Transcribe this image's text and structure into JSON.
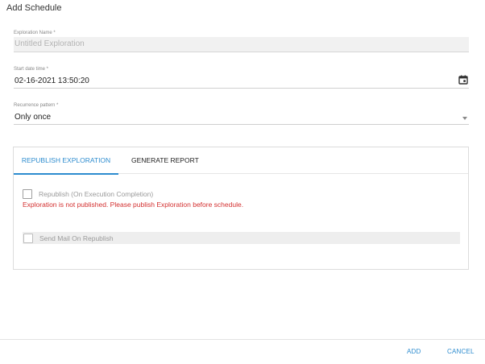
{
  "dialog": {
    "title": "Add Schedule"
  },
  "fields": {
    "exploration_name": {
      "label": "Exploration Name *",
      "value": "Untitled Exploration"
    },
    "start_datetime": {
      "label": "Start date time *",
      "value": "02-16-2021 13:50:20"
    },
    "recurrence": {
      "label": "Recurrence pattern *",
      "value": "Only once"
    }
  },
  "tabs": [
    {
      "label": "REPUBLISH EXPLORATION",
      "active": true
    },
    {
      "label": "GENERATE REPORT",
      "active": false
    }
  ],
  "republish": {
    "checkbox_label": "Republish (On Execution Completion)",
    "error": "Exploration is not published. Please publish Exploration before schedule.",
    "mail_label": "Send Mail On Republish"
  },
  "footer": {
    "add_label": "ADD",
    "cancel_label": "CANCEL"
  },
  "colors": {
    "accent": "#2d8ccf",
    "error": "#d32f2f"
  }
}
